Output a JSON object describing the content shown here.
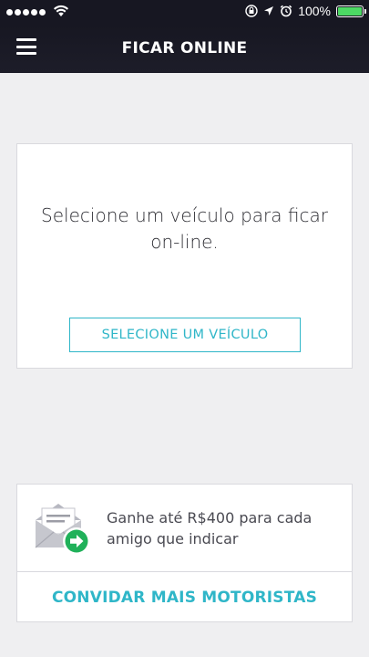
{
  "status_bar": {
    "battery_text": "100%",
    "icons": [
      "signal-dots-icon",
      "wifi-icon",
      "orientation-lock-icon",
      "location-arrow-icon",
      "alarm-icon",
      "battery-icon"
    ]
  },
  "header": {
    "title": "FICAR ONLINE",
    "menu_icon": "hamburger-menu-icon"
  },
  "vehicle_card": {
    "message": "Selecione um veículo para ficar on-line.",
    "button_label": "SELECIONE UM VEÍCULO"
  },
  "invite_card": {
    "promo_text": "Ganhe até R$400 para cada amigo que indicar",
    "button_label": "CONVIDAR MAIS MOTORISTAS",
    "icon": "envelope-arrow-icon"
  },
  "colors": {
    "accent": "#2fb6c8",
    "header_bg": "#171722",
    "page_bg": "#efeff1",
    "battery_green": "#4cd964",
    "badge_green": "#20b15a"
  }
}
